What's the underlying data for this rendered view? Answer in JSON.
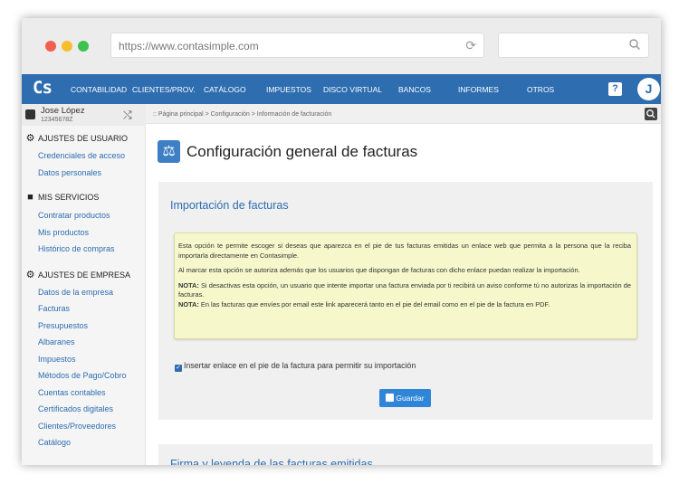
{
  "browser": {
    "url": "https://www.contasimple.com"
  },
  "app": {
    "logo": "Cs",
    "nav": [
      "CONTABILIDAD",
      "CLIENTES/PROV.",
      "CATÁLOGO",
      "IMPUESTOS",
      "DISCO VIRTUAL",
      "BANCOS",
      "INFORMES",
      "OTROS"
    ],
    "help": "?",
    "avatar": "J"
  },
  "user": {
    "name": "Jose López",
    "id": "12345678Z"
  },
  "sidebar": {
    "sections": [
      {
        "title": "AJUSTES DE USUARIO",
        "icon": "gear-icon",
        "items": [
          "Credenciales de acceso",
          "Datos personales"
        ]
      },
      {
        "title": "MIS SERVICIOS",
        "icon": "bag-icon",
        "items": [
          "Contratar productos",
          "Mis productos",
          "Histórico de compras"
        ]
      },
      {
        "title": "AJUSTES DE EMPRESA",
        "icon": "gear-icon",
        "items": [
          "Datos de la empresa",
          "Facturas",
          "Presupuestos",
          "Albaranes",
          "Impuestos",
          "Métodos de Pago/Cobro",
          "Cuentas contables",
          "Certificados digitales",
          "Clientes/Proveedores",
          "Catálogo"
        ]
      }
    ]
  },
  "breadcrumb": ":: Página principal > Configuración > Información de facturación",
  "page": {
    "title": "Configuración general de facturas",
    "panel_title": "Importación de facturas",
    "note": {
      "p1": "Esta opción te permite escoger si deseas que aparezca en el pie de tus facturas emitidas un enlace web que permita a la persona que la reciba importarla directamente en Contasimple.",
      "p2": "Al marcar esta opción se autoriza además que los usuarios que dispongan de facturas con dicho enlace puedan realizar la importación.",
      "nota_label": "NOTA:",
      "nota1": " Si desactivas esta opción, un usuario que intente importar una factura enviada por ti recibirá un aviso conforme tú no autorizas la importación de facturas.",
      "nota2": " En las facturas que envíes por email este link aparecerá tanto en el pie del email como en el pie de la factura en PDF."
    },
    "checkbox_label": "Insertar enlace en el pie de la factura para permitir su importación",
    "checkbox_checked": true,
    "save_label": "Guardar",
    "panel2_title": "Firma y leyenda de las facturas emitidas"
  },
  "colors": {
    "nav_bg": "#2d6db0",
    "note_bg": "#f6f8cb",
    "button": "#2f86d8"
  }
}
